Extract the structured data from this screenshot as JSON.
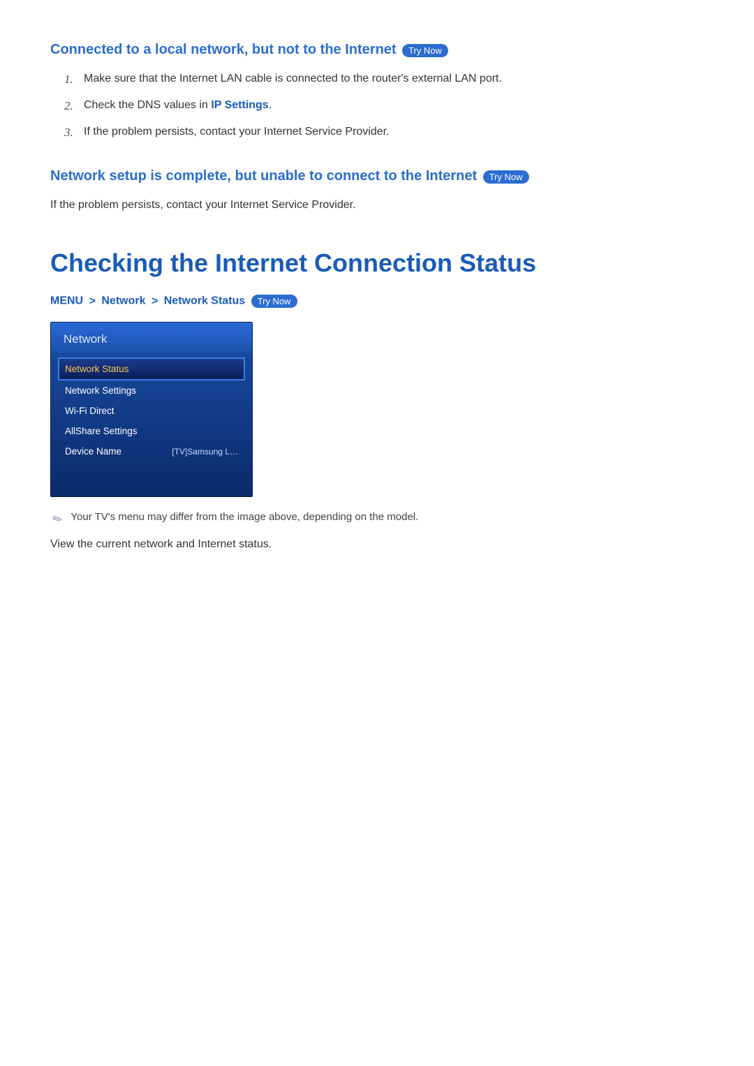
{
  "section1": {
    "title": "Connected to a local network, but not to the Internet",
    "try_now": "Try Now",
    "items": [
      "Make sure that the Internet LAN cable is connected to the router's external LAN port.",
      "Check the DNS values in ",
      "If the problem persists, contact your Internet Service Provider."
    ],
    "item2_bold": "IP Settings",
    "item2_suffix": "."
  },
  "section2": {
    "title": "Network setup is complete, but unable to connect to the Internet",
    "try_now": "Try Now",
    "para": "If the problem persists, contact your Internet Service Provider."
  },
  "main": {
    "title": "Checking the Internet Connection Status",
    "breadcrumb": {
      "a": "MENU",
      "b": "Network",
      "c": "Network Status",
      "try_now": "Try Now"
    },
    "menu": {
      "panel_title": "Network",
      "items": [
        {
          "label": "Network Status",
          "selected": true
        },
        {
          "label": "Network Settings"
        },
        {
          "label": "Wi-Fi Direct"
        },
        {
          "label": "AllShare Settings"
        },
        {
          "label": "Device Name",
          "value": "[TV]Samsung L…"
        }
      ]
    },
    "note": "Your TV's menu may differ from the image above, depending on the model.",
    "desc": "View the current network and Internet status."
  }
}
